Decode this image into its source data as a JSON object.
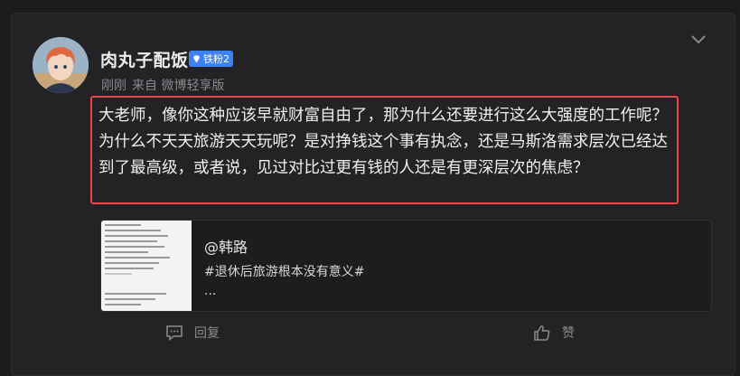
{
  "post": {
    "author": "肉丸子配饭",
    "fan_badge": "铁粉2",
    "time": "刚刚",
    "source": "来自 微博轻享版",
    "text": "大老师，像你这种应该早就财富自由了，那为什么还要进行这么大强度的工作呢？为什么不天天旅游天天玩呢？是对挣钱这个事有执念，还是马斯洛需求层次已经达到了最高级，或者说，见过对比过更有钱的人还是有更深层次的焦虑？"
  },
  "repost": {
    "author": "@韩路",
    "tag": "#退休后旅游根本没有意义#",
    "more": "..."
  },
  "actions": {
    "reply_label": "回复",
    "like_label": "赞"
  },
  "icons": [
    "avatar",
    "diamond-icon",
    "chevron-down-icon",
    "comment-icon",
    "thumbs-up-icon"
  ],
  "colors": {
    "highlight_border": "#e5484d",
    "badge_blue": "#3d82f0"
  }
}
